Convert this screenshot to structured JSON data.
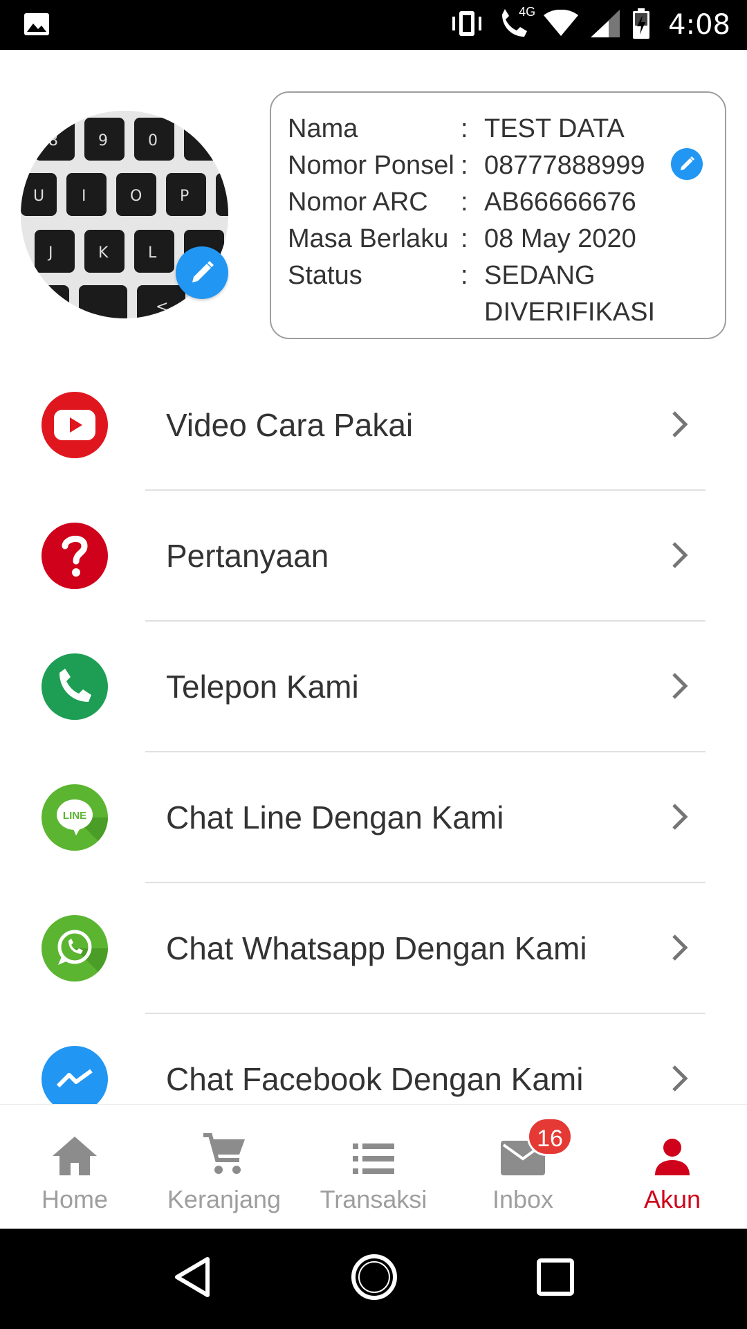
{
  "status_bar": {
    "time": "4:08",
    "network": "4G",
    "icons": [
      "image-icon",
      "vibrate-icon",
      "wifi-call-icon",
      "wifi-icon",
      "signal-icon",
      "battery-icon"
    ]
  },
  "profile": {
    "avatar_icon": "keyboard-photo",
    "edit_icon": "pencil-icon",
    "fields": [
      {
        "label": "Nama",
        "sep": ":",
        "value": "TEST DATA"
      },
      {
        "label": "Nomor Ponsel",
        "sep": ":",
        "value": "08777888999"
      },
      {
        "label": "Nomor ARC",
        "sep": ":",
        "value": "AB66666676"
      },
      {
        "label": "Masa Berlaku",
        "sep": ":",
        "value": "08 May 2020"
      },
      {
        "label": "Status",
        "sep": ":",
        "value": "SEDANG DIVERIFIKASI"
      }
    ]
  },
  "menu": {
    "items": [
      {
        "label": "Video Cara Pakai",
        "icon": "youtube-icon",
        "color": "#e0161e"
      },
      {
        "label": "Pertanyaan",
        "icon": "question-icon",
        "color": "#d0021b"
      },
      {
        "label": "Telepon Kami",
        "icon": "phone-icon",
        "color": "#1e9e55"
      },
      {
        "label": "Chat Line Dengan Kami",
        "icon": "line-icon",
        "color": "#5bb531"
      },
      {
        "label": "Chat Whatsapp Dengan Kami",
        "icon": "whatsapp-icon",
        "color": "#5bb531"
      },
      {
        "label": "Chat Facebook Dengan Kami",
        "icon": "messenger-icon",
        "color": "#2196f3"
      }
    ]
  },
  "bottom_nav": {
    "items": [
      {
        "label": "Home",
        "icon": "home-icon"
      },
      {
        "label": "Keranjang",
        "icon": "cart-icon"
      },
      {
        "label": "Transaksi",
        "icon": "list-icon"
      },
      {
        "label": "Inbox",
        "icon": "mail-icon",
        "badge": "16"
      },
      {
        "label": "Akun",
        "icon": "person-icon",
        "active": true
      }
    ],
    "active_color": "#d0021b",
    "inactive_color": "#9e9e9e"
  },
  "system_nav": {
    "icons": [
      "back-icon",
      "home-circle-icon",
      "recents-icon"
    ]
  }
}
